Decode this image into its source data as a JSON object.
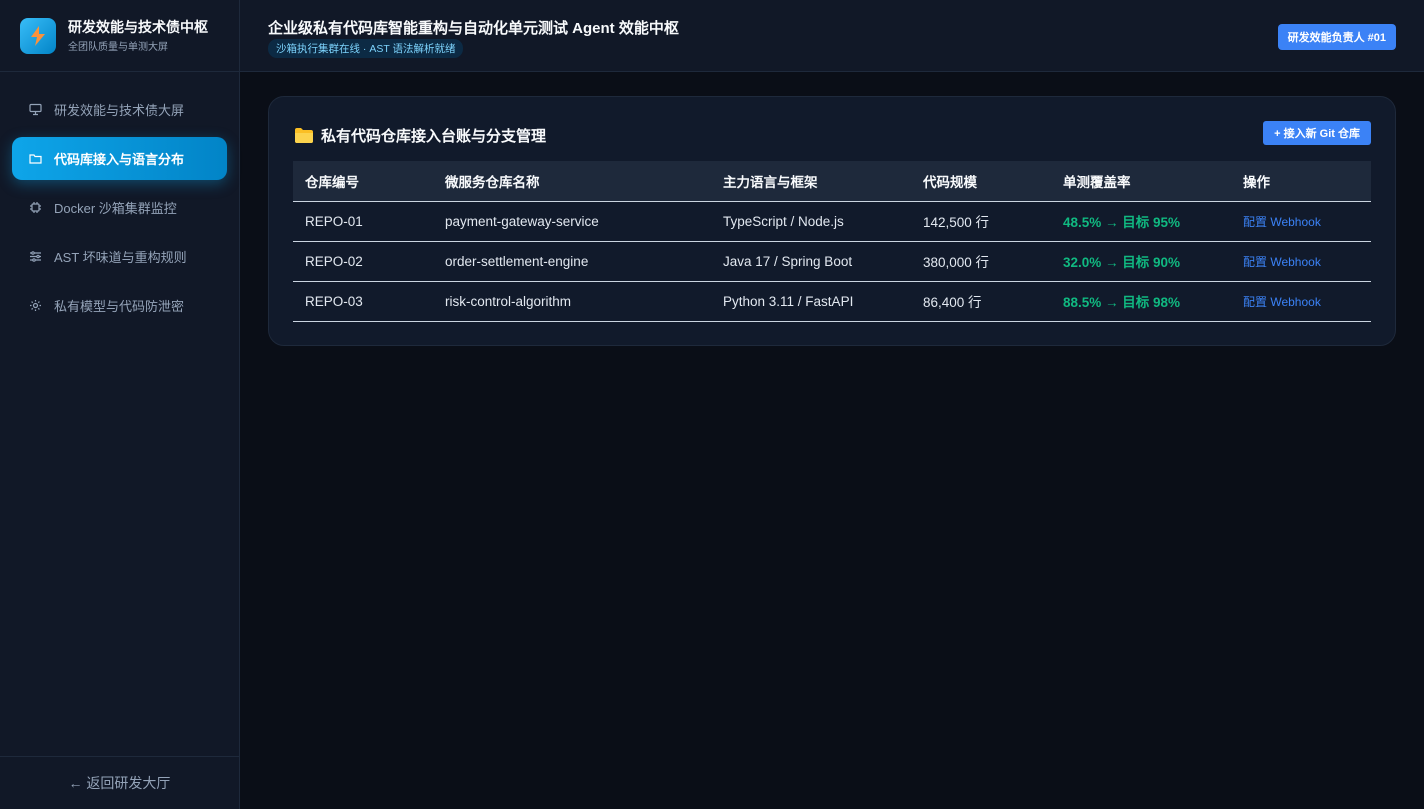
{
  "brand": {
    "title": "研发效能与技术债中枢",
    "subtitle": "全团队质量与单测大屏",
    "logo_icon": "lightning-icon"
  },
  "sidebar": {
    "items": [
      {
        "label": "研发效能与技术债大屏",
        "icon": "monitor-icon",
        "active": false
      },
      {
        "label": "代码库接入与语言分布",
        "icon": "folder-icon",
        "active": true
      },
      {
        "label": "Docker 沙箱集群监控",
        "icon": "chip-icon",
        "active": false
      },
      {
        "label": "AST 坏味道与重构规则",
        "icon": "sliders-icon",
        "active": false
      },
      {
        "label": "私有模型与代码防泄密",
        "icon": "gear-icon",
        "active": false
      }
    ],
    "footer_label": "← 返回研发大厅"
  },
  "header": {
    "title": "企业级私有代码库智能重构与自动化单元测试 Agent 效能中枢",
    "status": "沙箱执行集群在线 · AST 语法解析就绪",
    "user_badge": "研发效能负责人 #01"
  },
  "repo_panel": {
    "title": "私有代码仓库接入台账与分支管理",
    "add_button": "+ 接入新 Git 仓库",
    "columns": [
      "仓库编号",
      "微服务仓库名称",
      "主力语言与框架",
      "代码规模",
      "单测覆盖率",
      "操作"
    ],
    "rows": [
      {
        "id": "REPO-01",
        "name": "payment-gateway-service",
        "lang": "TypeScript / Node.js",
        "size": "142,500 行",
        "coverage": "48.5% → 目标 95%",
        "action": "配置 Webhook"
      },
      {
        "id": "REPO-02",
        "name": "order-settlement-engine",
        "lang": "Java 17 / Spring Boot",
        "size": "380,000 行",
        "coverage": "32.0% → 目标 90%",
        "action": "配置 Webhook"
      },
      {
        "id": "REPO-03",
        "name": "risk-control-algorithm",
        "lang": "Python 3.11 / FastAPI",
        "size": "86,400 行",
        "coverage": "88.5% → 目标 98%",
        "action": "配置 Webhook"
      }
    ]
  },
  "colors": {
    "accent": "#0ea5e9",
    "button": "#3b82f6",
    "coverage": "#10b981",
    "background": "#0a0e17"
  }
}
